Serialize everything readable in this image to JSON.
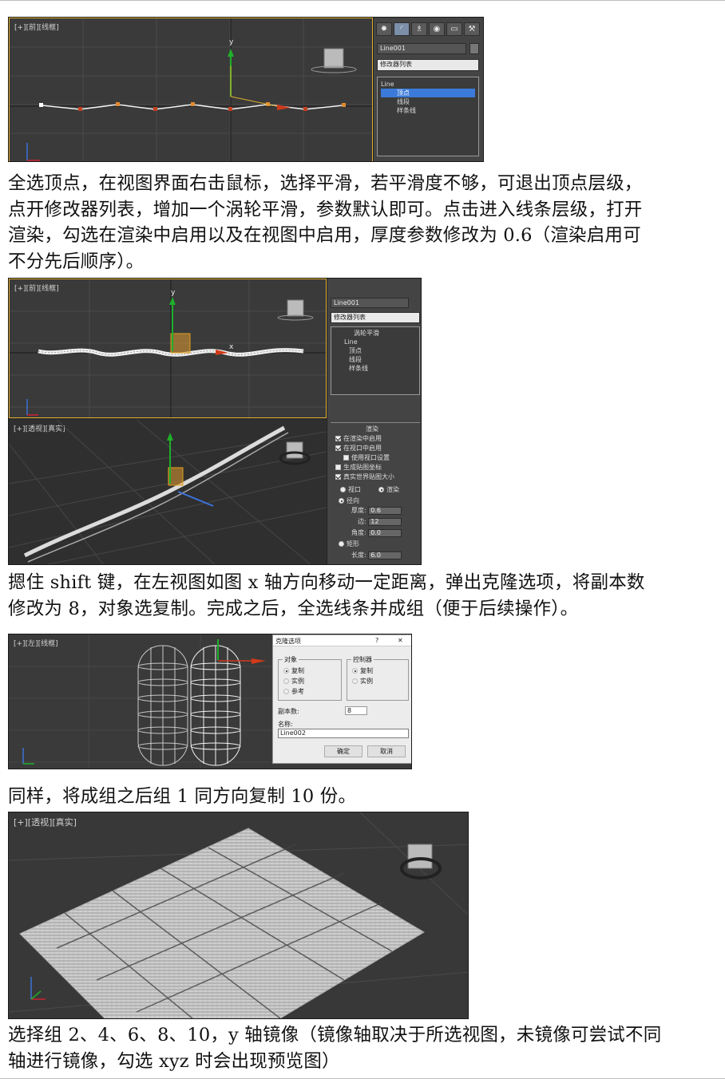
{
  "paragraphs": [
    [
      "全选顶点，在视图界面右击鼠标，选择平滑，若平滑度不够，可退出顶点层级，",
      "点开修改器列表，增加一个涡轮平滑，参数默认即可。点击进入线条层级，打开",
      "渲染，勾选在渲染中启用以及在视图中启用，厚度参数修改为 0.6（渲染启用可",
      "不分先后顺序）。"
    ],
    [
      "摁住 shift 键，在左视图如图 x 轴方向移动一定距离，弹出克隆选项，将副本数",
      "修改为 8，对象选复制。完成之后，全选线条并成组（便于后续操作）。"
    ],
    [
      "同样，将成组之后组 1 同方向复制 10 份。"
    ],
    [
      "选择组 2、4、6、8、10，y 轴镜像（镜像轴取决于所选视图，未镜像可尝试不同",
      "轴进行镜像，勾选 xyz 时会出现预览图）"
    ]
  ],
  "screenshot1": {
    "viewport_label": "[+][前][线框]",
    "axis_label": "y",
    "panel": {
      "tabs": [
        "✹",
        "◜",
        "♗",
        "◉",
        "▭",
        "⚒"
      ],
      "object_name": "Line001",
      "modifier_list": "修改器列表",
      "stack": [
        "Line",
        "顶点",
        "线段",
        "样条线"
      ],
      "selected": "顶点"
    }
  },
  "screenshot2": {
    "front_label": "[+][前][线框]",
    "persp_label": "[+][透视][真实]",
    "axis_y": "y",
    "axis_x": "x",
    "panel": {
      "object_name": "Line001",
      "modifier_list": "修改器列表",
      "stack": [
        "涡轮平滑",
        "Line",
        "顶点",
        "线段",
        "样条线"
      ],
      "rollout_title": "渲染",
      "checks": [
        "在渲染中启用",
        "在视口中启用",
        "使用视口设置",
        "生成贴图坐标",
        "真实世界贴图大小"
      ],
      "viewport_opt": "视口",
      "render_opt": "渲染",
      "radial": "径向",
      "thickness_label": "厚度:",
      "thickness_value": "0.6",
      "sides_label": "边:",
      "sides_value": "12",
      "angle_label": "角度:",
      "angle_value": "0.0",
      "rect": "矩形",
      "length_label": "长度:",
      "length_value": "6.0"
    }
  },
  "screenshot3": {
    "viewport_label": "[+][左][线框]",
    "dialog": {
      "title": "克隆选项",
      "help": "?",
      "close": "✕",
      "object_group": "对象",
      "object_options": [
        "复制",
        "实例",
        "参考"
      ],
      "controller_group": "控制器",
      "controller_options": [
        "复制",
        "实例"
      ],
      "copies_label": "副本数:",
      "copies_value": "8",
      "name_label": "名称:",
      "name_value": "Line002",
      "ok": "确定",
      "cancel": "取消"
    }
  },
  "screenshot4": {
    "viewport_label": "[+][透视][真实]"
  }
}
